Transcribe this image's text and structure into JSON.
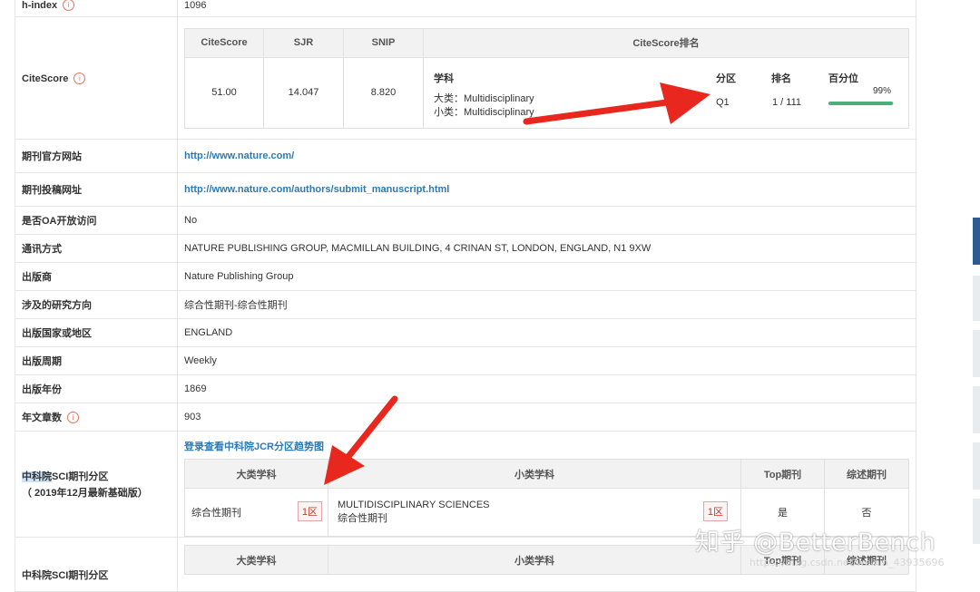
{
  "rows": {
    "hindex": {
      "label": "h-index",
      "value": "1096"
    },
    "citescore": {
      "label": "CiteScore"
    },
    "website": {
      "label": "期刊官方网站",
      "value": "http://www.nature.com/"
    },
    "submit": {
      "label": "期刊投稿网址",
      "value": "http://www.nature.com/authors/submit_manuscript.html"
    },
    "oa": {
      "label": "是否OA开放访问",
      "value": "No"
    },
    "contact": {
      "label": "通讯方式",
      "value": "NATURE PUBLISHING GROUP, MACMILLAN BUILDING, 4 CRINAN ST, LONDON, ENGLAND, N1 9XW"
    },
    "publisher": {
      "label": "出版商",
      "value": "Nature Publishing Group"
    },
    "research": {
      "label": "涉及的研究方向",
      "value": "综合性期刊-综合性期刊"
    },
    "country": {
      "label": "出版国家或地区",
      "value": "ENGLAND"
    },
    "cycle": {
      "label": "出版周期",
      "value": "Weekly"
    },
    "year": {
      "label": "出版年份",
      "value": "1869"
    },
    "articles": {
      "label": "年文章数",
      "value": "903"
    },
    "cas": {
      "label_highlight": "中科院",
      "label_rest": "SCI期刊分区",
      "label_sub": "（ 2019年12月最新基础版）"
    },
    "cas2": {
      "label": "中科院SCI期刊分区"
    }
  },
  "citescore_table": {
    "headers": [
      "CiteScore",
      "SJR",
      "SNIP",
      "CiteScore排名"
    ],
    "values": [
      "51.00",
      "14.047",
      "8.820"
    ],
    "rank": {
      "subject_header": "学科",
      "quartile_header": "分区",
      "rank_header": "排名",
      "percentile_header": "百分位",
      "major": "大类：Multidisciplinary",
      "minor": "小类：Multidisciplinary",
      "quartile": "Q1",
      "rank": "1 / 111",
      "percentile_text": "99%",
      "percentile": 99
    }
  },
  "zone_table": {
    "link": "登录查看中科院JCR分区趋势图",
    "headers": [
      "大类学科",
      "小类学科",
      "Top期刊",
      "综述期刊"
    ],
    "major_subject": "综合性期刊",
    "major_zone": "1区",
    "minor_subject_en": "MULTIDISCIPLINARY SCIENCES",
    "minor_subject_cn": "综合性期刊",
    "minor_zone": "1区",
    "top": "是",
    "review": "否"
  },
  "zone_table2": {
    "headers": [
      "大类学科",
      "小类学科",
      "Top期刊",
      "综述期刊"
    ]
  },
  "info_icon": "i",
  "watermark": {
    "main": "知乎 @BetterBench",
    "sub": "https://blog.csdn.net/weixin_43935696"
  },
  "colors": {
    "link": "#2a7ab8",
    "arrow": "#e8281e",
    "bar": "#4caf7a",
    "badge": "#c0392b"
  }
}
